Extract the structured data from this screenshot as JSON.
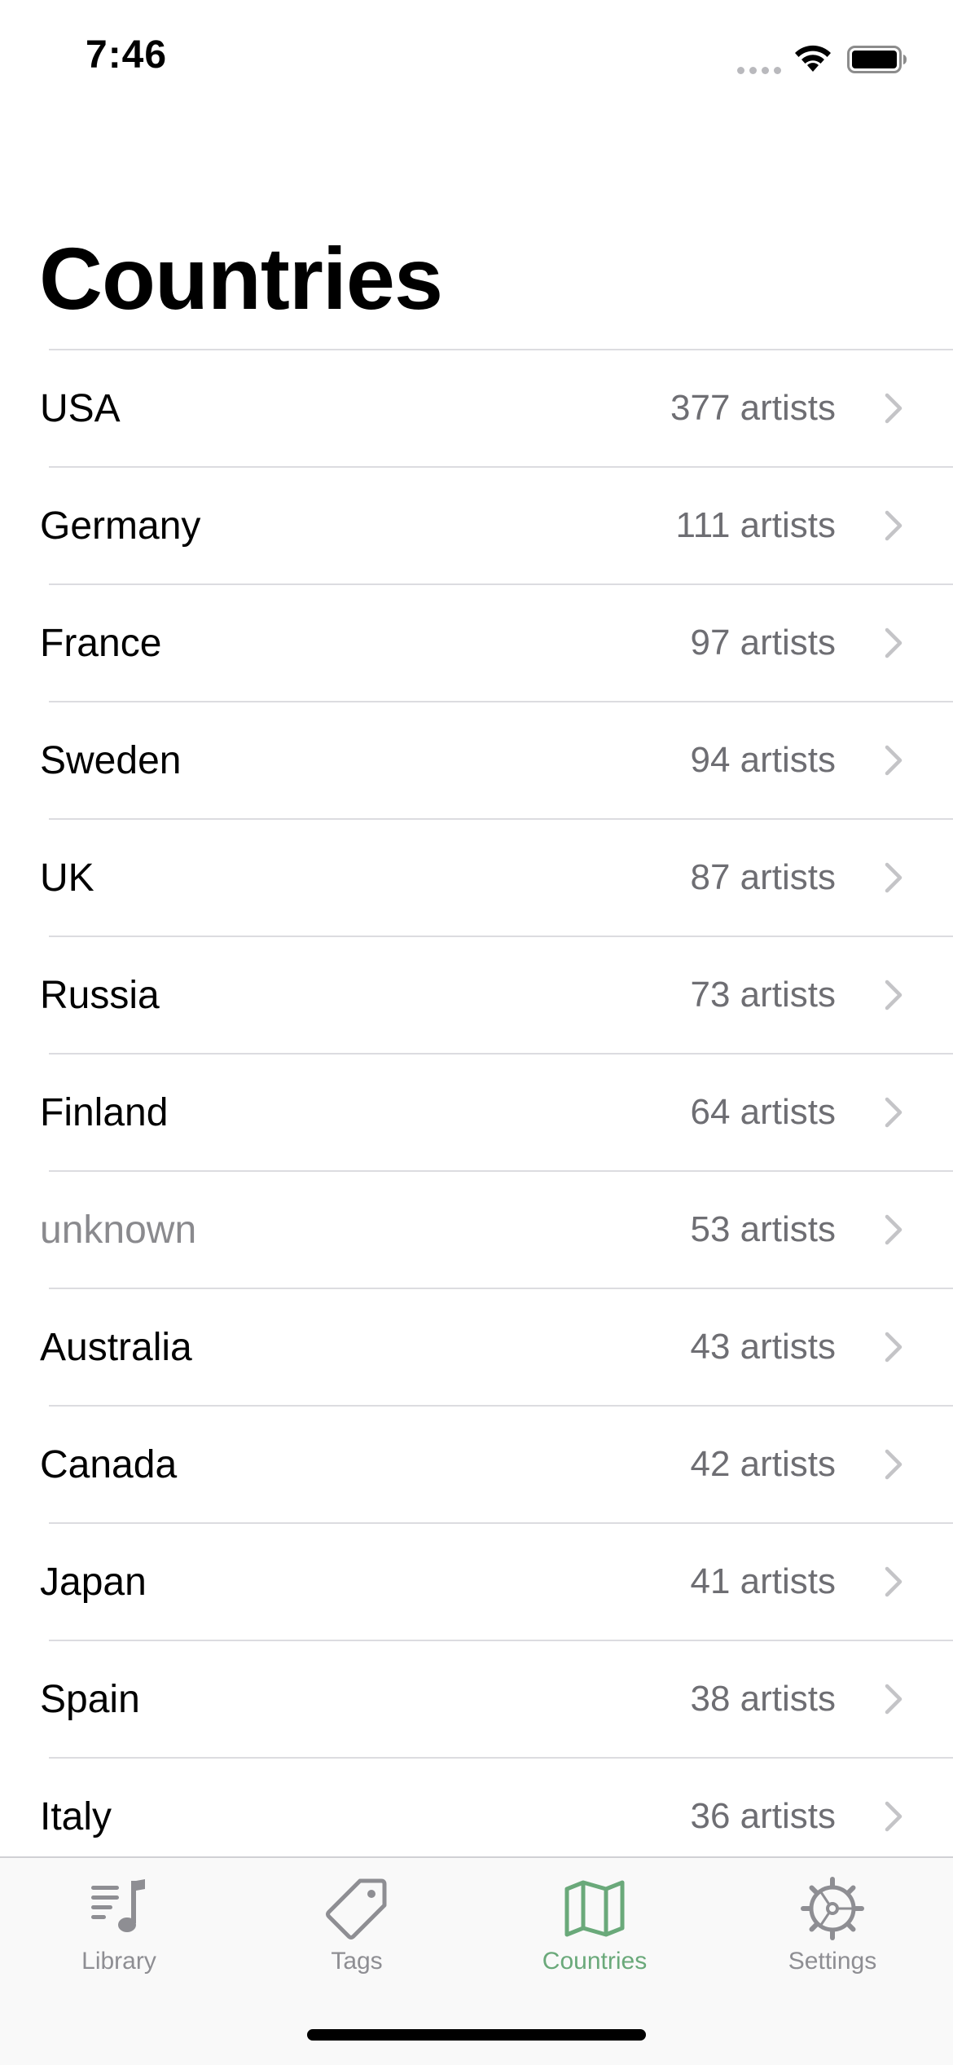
{
  "status_bar": {
    "time": "7:46"
  },
  "header": {
    "title": "Countries"
  },
  "countries": [
    {
      "name": "USA",
      "count": "377 artists",
      "muted": false
    },
    {
      "name": "Germany",
      "count": "111 artists",
      "muted": false
    },
    {
      "name": "France",
      "count": "97 artists",
      "muted": false
    },
    {
      "name": "Sweden",
      "count": "94 artists",
      "muted": false
    },
    {
      "name": "UK",
      "count": "87 artists",
      "muted": false
    },
    {
      "name": "Russia",
      "count": "73 artists",
      "muted": false
    },
    {
      "name": "Finland",
      "count": "64 artists",
      "muted": false
    },
    {
      "name": "unknown",
      "count": "53 artists",
      "muted": true
    },
    {
      "name": "Australia",
      "count": "43 artists",
      "muted": false
    },
    {
      "name": "Canada",
      "count": "42 artists",
      "muted": false
    },
    {
      "name": "Japan",
      "count": "41 artists",
      "muted": false
    },
    {
      "name": "Spain",
      "count": "38 artists",
      "muted": false
    },
    {
      "name": "Italy",
      "count": "36 artists",
      "muted": false
    }
  ],
  "tab_bar": {
    "tabs": [
      {
        "label": "Library",
        "icon": "music-library-icon",
        "active": false
      },
      {
        "label": "Tags",
        "icon": "tag-icon",
        "active": false
      },
      {
        "label": "Countries",
        "icon": "map-icon",
        "active": true
      },
      {
        "label": "Settings",
        "icon": "gear-icon",
        "active": false
      }
    ]
  },
  "colors": {
    "accent": "#6aa97a",
    "inactive": "#8e8e93",
    "secondary_text": "#6e6e73"
  }
}
